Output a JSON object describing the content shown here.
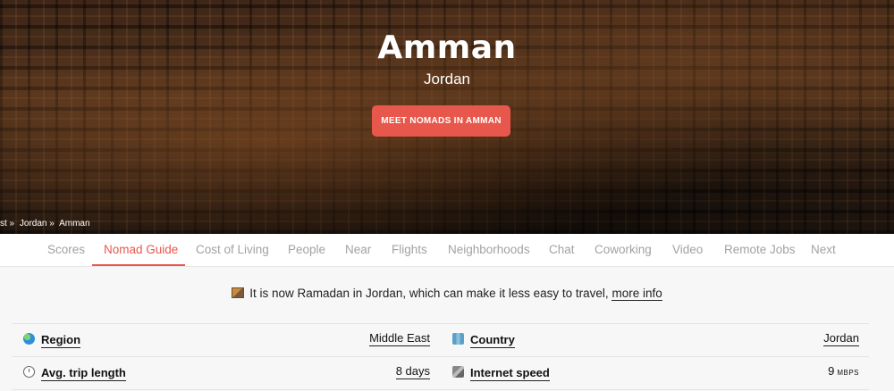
{
  "hero": {
    "title": "Amman",
    "subtitle": "Jordan",
    "cta_label": "MEET NOMADS IN AMMAN",
    "breadcrumb": [
      "st »",
      "Jordan »",
      "Amman"
    ]
  },
  "tabs": [
    {
      "label": "Scores",
      "active": false
    },
    {
      "label": "Nomad Guide",
      "active": true
    },
    {
      "label": "Cost of Living",
      "active": false
    },
    {
      "label": "People",
      "active": false
    },
    {
      "label": "Near",
      "active": false
    },
    {
      "label": "Flights",
      "active": false
    },
    {
      "label": "Neighborhoods",
      "active": false
    },
    {
      "label": "Chat",
      "active": false
    },
    {
      "label": "Coworking",
      "active": false
    },
    {
      "label": "Video",
      "active": false
    },
    {
      "label": "Remote Jobs",
      "active": false
    },
    {
      "label": "Next",
      "active": false
    }
  ],
  "notice": {
    "text": "It is now Ramadan in Jordan, which can make it less easy to travel,",
    "link": "more info",
    "icon": "ramadan-icon"
  },
  "info": {
    "region": {
      "icon": "globe-icon",
      "label": "Region",
      "value": "Middle East"
    },
    "country": {
      "icon": "map-icon",
      "label": "Country",
      "value": "Jordan"
    },
    "trip": {
      "icon": "stopwatch-icon",
      "label": "Avg. trip length",
      "value": "8 days"
    },
    "internet": {
      "icon": "satellite-icon",
      "label": "Internet speed",
      "value": "9",
      "unit": "MBPS"
    }
  },
  "colors": {
    "accent": "#e8574b",
    "tab_inactive": "#a2a2a2"
  }
}
